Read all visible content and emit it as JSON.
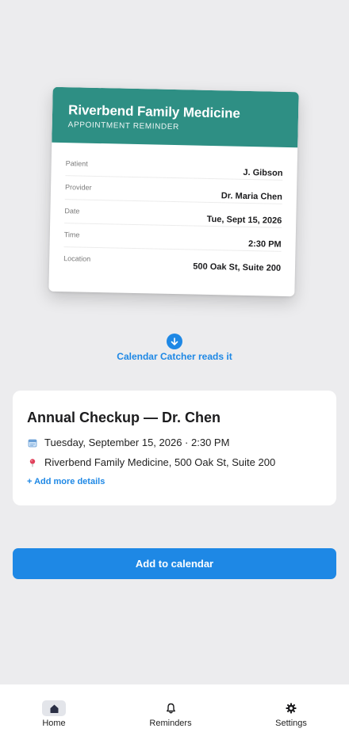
{
  "appointment_card": {
    "title": "Riverbend Family Medicine",
    "subtitle": "APPOINTMENT REMINDER",
    "rows": [
      {
        "label": "Patient",
        "value": "J. Gibson"
      },
      {
        "label": "Provider",
        "value": "Dr. Maria Chen"
      },
      {
        "label": "Date",
        "value": "Tue, Sept 15, 2026"
      },
      {
        "label": "Time",
        "value": "2:30 PM"
      },
      {
        "label": "Location",
        "value": "500 Oak St, Suite 200"
      }
    ],
    "header_color": "#2e8f84"
  },
  "arrow": {
    "icon": "arrow-down-icon",
    "caption": "Calendar Catcher reads it"
  },
  "event": {
    "title": "Annual Checkup — Dr. Chen",
    "datetime_icon": "calendar-icon",
    "datetime": "Tuesday, September 15, 2026 · 2:30 PM",
    "location_icon": "map-pin-icon",
    "location": "Riverbend Family Medicine, 500 Oak St, Suite 200",
    "add_details_label": "+ Add more details"
  },
  "primary_action": {
    "label": "Add to calendar"
  },
  "bottom_nav": {
    "items": [
      {
        "label": "Home",
        "icon": "home-icon",
        "active": true
      },
      {
        "label": "Reminders",
        "icon": "bell-icon",
        "active": false
      },
      {
        "label": "Settings",
        "icon": "gear-icon",
        "active": false
      }
    ]
  },
  "colors": {
    "accent": "#1e88e5",
    "teal": "#2e8f84",
    "background": "#ececee"
  }
}
